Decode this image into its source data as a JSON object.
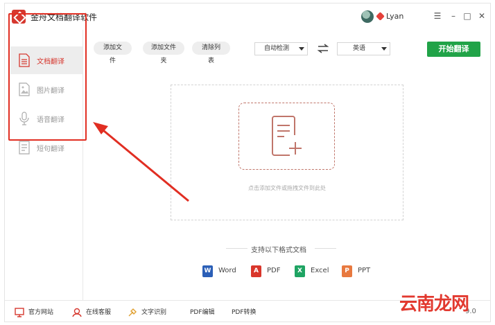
{
  "app": {
    "title": "金舟文档翻译软件",
    "brand_color": "#d6382f"
  },
  "user": {
    "name": "Lyan"
  },
  "window_controls": {
    "menu": "☰",
    "minimize": "–",
    "maximize": "□",
    "close": "✕"
  },
  "sidebar": {
    "items": [
      {
        "label": "文档翻译",
        "icon": "document-icon",
        "active": true
      },
      {
        "label": "图片翻译",
        "icon": "image-icon",
        "active": false
      },
      {
        "label": "语音翻译",
        "icon": "microphone-icon",
        "active": false
      },
      {
        "label": "短句翻译",
        "icon": "sentence-icon",
        "active": false
      }
    ]
  },
  "toolbar": {
    "add_file": "添加文件",
    "add_folder": "添加文件夹",
    "clear_list": "清除列表",
    "source_lang": "自动检测",
    "target_lang": "英语",
    "start": "开始翻译",
    "start_color": "#21a348"
  },
  "dropzone": {
    "hint": "点击添加文件或拖拽文件到此处"
  },
  "formats": {
    "title": "支持以下格式文档",
    "items": [
      {
        "label": "Word",
        "badge": "W",
        "color": "#2b5fb7"
      },
      {
        "label": "PDF",
        "badge": "A",
        "color": "#d9362b"
      },
      {
        "label": "Excel",
        "badge": "X",
        "color": "#1fa463"
      },
      {
        "label": "PPT",
        "badge": "P",
        "color": "#e8793f"
      }
    ]
  },
  "bottombar": {
    "website": "官方网站",
    "support": "在线客服",
    "ocr": "文字识别",
    "pdf_edit": "PDF编辑",
    "pdf_convert": "PDF转换",
    "version": "9.0"
  },
  "watermark": "云南龙网"
}
